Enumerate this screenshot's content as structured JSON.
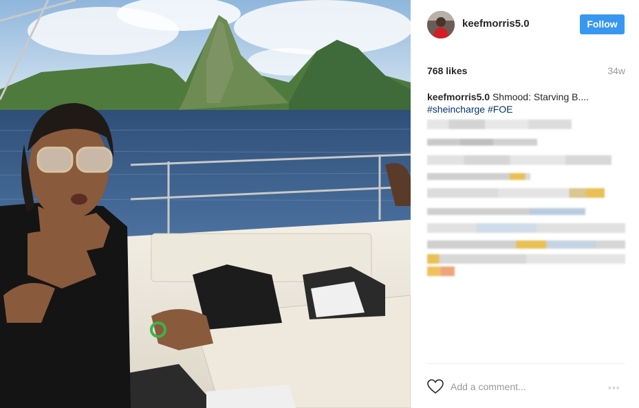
{
  "header": {
    "username": "keefmorris5.0",
    "follow_label": "Follow"
  },
  "stats": {
    "likes": "768 likes",
    "age": "34w"
  },
  "caption": {
    "username": "keefmorris5.0",
    "text": "Shmood: Starving B....",
    "hashtags": [
      "#sheincharge",
      "#FOE"
    ]
  },
  "comment_box": {
    "placeholder": "Add a comment..."
  },
  "icons": {
    "heart": "heart-icon",
    "more": "more-options-icon",
    "more_glyph": "◦◦◦"
  },
  "colors": {
    "follow_button": "#3897f0",
    "hashtag": "#003569",
    "muted_text": "#999999"
  }
}
